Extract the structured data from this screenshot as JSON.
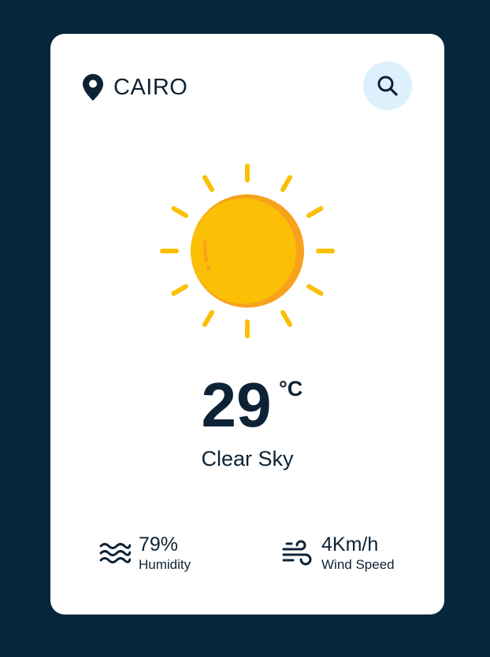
{
  "location": {
    "city": "CAIRO",
    "icon": "map-pin-icon"
  },
  "search": {
    "icon": "search-icon"
  },
  "weather": {
    "icon": "sun-icon",
    "temperature": "29",
    "unit": "°C",
    "condition": "Clear Sky"
  },
  "stats": {
    "humidity": {
      "value": "79%",
      "label": "Humidity",
      "icon": "waves-icon"
    },
    "wind": {
      "value": "4Km/h",
      "label": "Wind Speed",
      "icon": "wind-icon"
    }
  },
  "colors": {
    "background": "#06263b",
    "card": "#ffffff",
    "text": "#0d2235",
    "search_button": "#dcf1fb",
    "sun_yellow": "#fbbf06",
    "sun_orange": "#f7a21b"
  }
}
